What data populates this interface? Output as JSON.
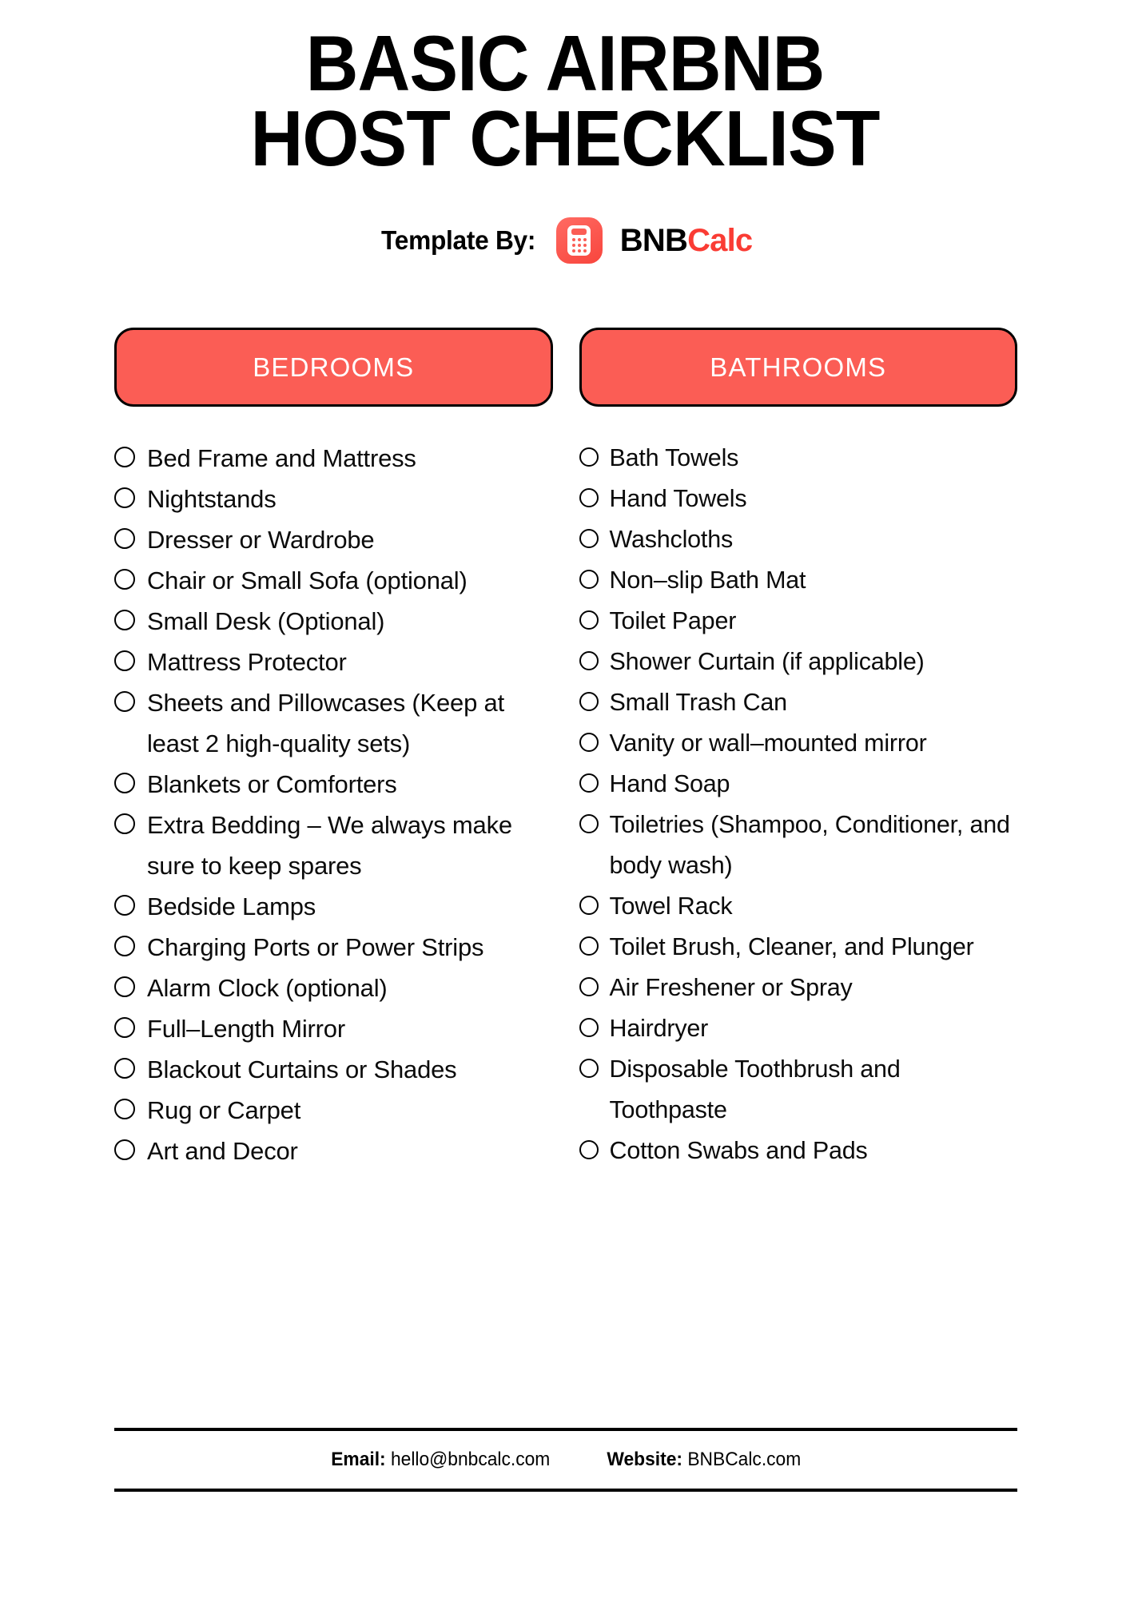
{
  "document": {
    "title_line1": "BASIC AIRBNB",
    "title_line2": "HOST CHECKLIST"
  },
  "brand": {
    "prefix": "Template By:",
    "logo_icon": "calculator-icon",
    "name_dark": "BNB",
    "name_accent": "Calc",
    "accent_color": "#FA3C34",
    "tile_color": "#FB5D55"
  },
  "theme": {
    "accent_red": "#FB5D55",
    "border_black": "#000000",
    "text_black": "#0B0B0B",
    "background": "#FFFFFF"
  },
  "sections": [
    {
      "id": "bedrooms",
      "header": "BEDROOMS",
      "items": [
        "Bed Frame and Mattress",
        "Nightstands",
        "Dresser or Wardrobe",
        "Chair or Small Sofa (optional)",
        "Small Desk (Optional)",
        "Mattress Protector",
        "Sheets and Pillowcases (Keep at least 2 high-quality sets)",
        "Blankets or Comforters",
        "Extra Bedding – We always make sure to keep spares",
        "Bedside Lamps",
        "Charging Ports or Power Strips",
        "Alarm Clock (optional)",
        "Full–Length Mirror",
        "Blackout Curtains or Shades",
        "Rug or Carpet",
        "Art and Decor"
      ]
    },
    {
      "id": "bathrooms",
      "header": "BATHROOMS",
      "items": [
        "Bath Towels",
        "Hand Towels",
        "Washcloths",
        "Non–slip Bath Mat",
        "Toilet Paper",
        "Shower Curtain (if applicable)",
        "Small Trash Can",
        "Vanity or wall–mounted mirror",
        "Hand Soap",
        "Toiletries (Shampoo, Conditioner, and body wash)",
        "Towel Rack",
        "Toilet Brush, Cleaner, and Plunger",
        "Air Freshener or Spray",
        "Hairdryer",
        "Disposable Toothbrush and Toothpaste",
        "Cotton Swabs and Pads"
      ]
    }
  ],
  "footer": {
    "email_label": "Email:",
    "email_value": "hello@bnbcalc.com",
    "website_label": "Website:",
    "website_value": "BNBCalc.com"
  }
}
